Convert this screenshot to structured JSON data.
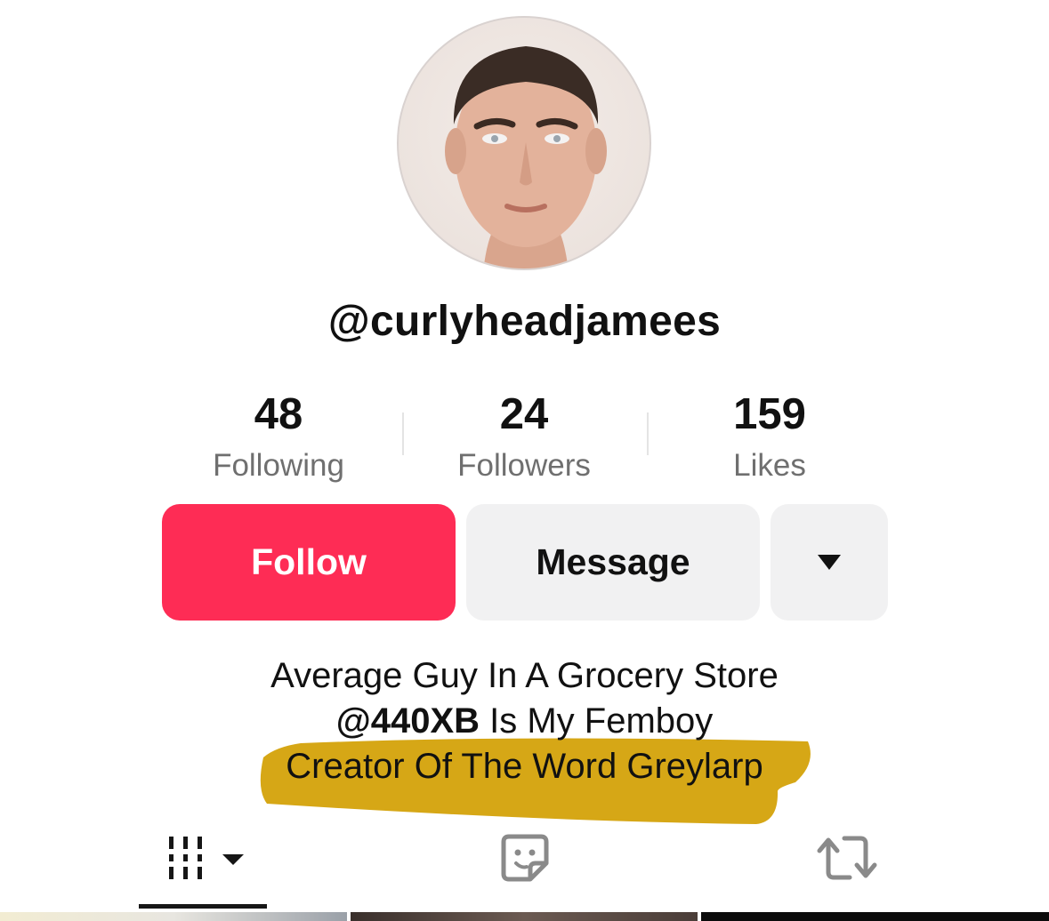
{
  "profile": {
    "username": "@curlyheadjamees",
    "avatar_icon": "profile-photo"
  },
  "stats": [
    {
      "value": "48",
      "label": "Following"
    },
    {
      "value": "24",
      "label": "Followers"
    },
    {
      "value": "159",
      "label": "Likes"
    }
  ],
  "actions": {
    "follow_label": "Follow",
    "message_label": "Message",
    "more_icon": "caret-down-icon"
  },
  "bio": {
    "line1": "Average Guy In A Grocery Store",
    "line2_mention": "@440XB",
    "line2_rest": " Is My Femboy",
    "line3": "Creator Of The Word Greylarp"
  },
  "tabs": [
    {
      "icon": "videos-grid-icon",
      "selected": true
    },
    {
      "icon": "liked-sticker-icon",
      "selected": false
    },
    {
      "icon": "repost-icon",
      "selected": false
    }
  ],
  "colors": {
    "follow": "#fe2c55",
    "secondary_button": "#f1f1f2",
    "highlight": "#d4a20a",
    "muted_text": "#6f6f6f"
  }
}
